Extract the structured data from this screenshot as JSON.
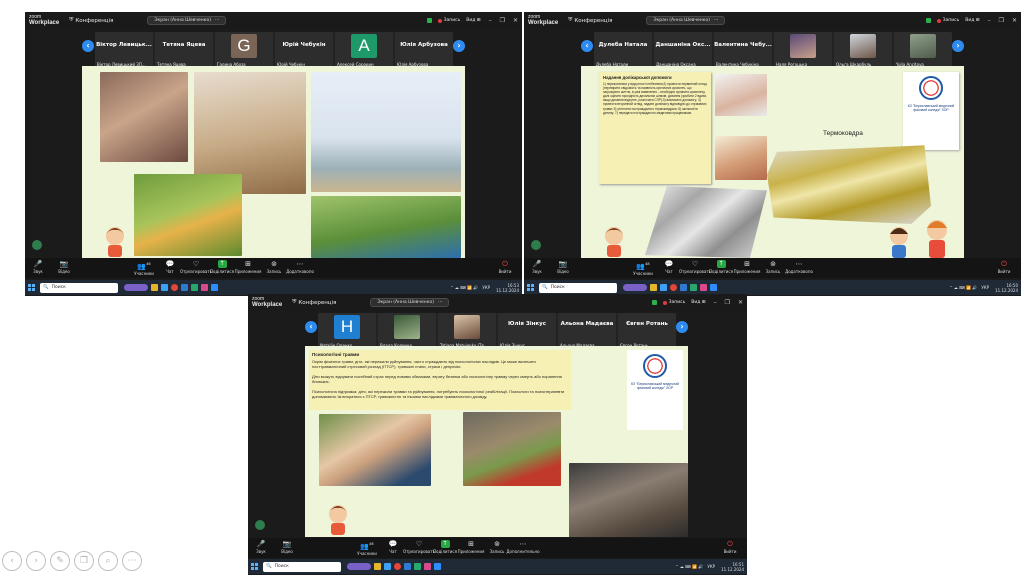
{
  "zoom": {
    "app_line1": "zoom",
    "app_line2": "Workplace",
    "conference": "Конференція",
    "screen_share": "Экран (Анна Шевченко)",
    "recording": "Запись",
    "view": "Вид"
  },
  "toolbar": {
    "audio": "Звук",
    "video": "Відео",
    "participants": "Учасники",
    "participants_count_a": "46",
    "participants_count_b": "48",
    "chat": "Чат",
    "react": "Отреагировать",
    "share": "Поділитися",
    "apps": "Приложения",
    "record": "Запись",
    "more": "Додатковопо",
    "more_c": "Дополнительно",
    "leave": "Вийти"
  },
  "taskbar": {
    "search": "Поиск",
    "lang": "УКР",
    "date": "11.12.2024",
    "time_a": "16:53",
    "time_b": "16:50",
    "time_c": "16:51"
  },
  "panel_a": {
    "participants": [
      {
        "top": "Віктор Левицьк...",
        "bottom": "Віктор Левицький ЗП..."
      },
      {
        "top": "Тетяна Яцева",
        "bottom": "Тетяна Яцева"
      },
      {
        "avatar": "G",
        "bottom": "Галина Абоза"
      },
      {
        "top": "Юрій Чебукін",
        "bottom": "Юрій Чебукін"
      },
      {
        "avatar": "A",
        "bottom": "Алексей Сорокин"
      },
      {
        "top": "Юлія Арбузова",
        "bottom": "Юлія Арбузова"
      }
    ]
  },
  "panel_b": {
    "participants": [
      {
        "top": "Дулеба Натала",
        "bottom": "Дулеба Натали"
      },
      {
        "top": "Даншаніна Окс...",
        "bottom": "Даншаніна Оксана"
      },
      {
        "top": "Валентина Чебу...",
        "bottom": "Валентина Чебукіна"
      },
      {
        "bottom": "Наля Рогоцька"
      },
      {
        "bottom": "Ольга Шкарбуль"
      },
      {
        "bottom": "Yulia Ancitova"
      }
    ],
    "slide_heading": "Надання долікарської допомоги",
    "slide_body": "1) переконатися у відсутності небезпеки;2) провести первинний огляд (перевірити свідомість та наявність критичних кровотеч, що загрожують життю, в разі виявлення – необхідно зупинити кровотечу, далі оцінити прохідність дихальних шляхів, дихання (зробити 2 вдихи, якщо дихання відсутнє, розпочати СЛР);3) викликати допомогу; 4) провести вторинний огляд, надати допомогу відповідно до отриманих травм; 5) утеплити постраждалого термоковдрою; 6) заспокоїти дитину; 7) передати постраждалого медичним працівникам.",
    "org_name": "КЗ \"Бериславський медичний фаховий коледж\" ХОР",
    "thermo_label": "Термоковдра"
  },
  "panel_c": {
    "participants": [
      {
        "avatar": "H",
        "bottom": "Nataliie Оденко"
      },
      {
        "bottom": "Влада Коленко"
      },
      {
        "bottom": "Tatiana Matvienko (Тв..."
      },
      {
        "top": "Юлія Зінкус",
        "bottom": "Юлія Зінкус"
      },
      {
        "top": "Альона Мадаєва",
        "bottom": "Альона Мадаєва"
      },
      {
        "top": "Євген Ротань",
        "bottom": "Євген Ротань"
      }
    ],
    "slide_heading": "Психологічні травми",
    "slide_p1": "Окрім фізичних травм, діти, які пережили руйнування, часто страждають від психологічних наслідків. Це може включати посттравматичний стресовий розлад (ПТСР), тривожні стани, страхи і депресію.",
    "slide_p2": "Діти можуть відчувати постійний страх перед новими обвалами, втрату безпеки або психологічну травму через смерть або поранення близьких.",
    "slide_p3": "Психологічна підтримка: діти, які пережили травми та руйнування, потребують психологічної реабілітації. Психологи та психотерапевти допомагають їм впоратися з ПТСР, тривожністю та іншими наслідками травматичного досвіду.",
    "org_name": "КЗ \"Бериславський медичний фаховий коледж\" ХОР"
  },
  "viewer_controls": [
    "prev",
    "next",
    "pen",
    "copy",
    "zoom",
    "more"
  ]
}
